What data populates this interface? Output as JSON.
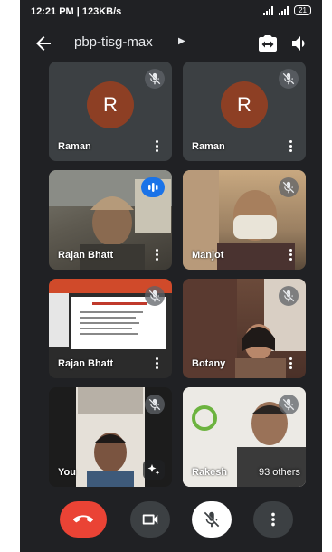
{
  "status_bar": {
    "time_speed": "12:21 PM | 123KB/s",
    "battery": "21"
  },
  "meeting": {
    "title": "pbp-tisg-max"
  },
  "tiles": [
    {
      "name": "Raman",
      "avatar_letter": "R"
    },
    {
      "name": "Raman",
      "avatar_letter": "R"
    },
    {
      "name": "Rajan Bhatt"
    },
    {
      "name": "Manjot"
    },
    {
      "name": "Rajan Bhatt"
    },
    {
      "name": "Botany"
    },
    {
      "name": "You"
    },
    {
      "name": "Rakesh",
      "others": "93 others"
    }
  ],
  "colors": {
    "background": "#202124",
    "avatar": "#8d3f24",
    "end_call": "#ea4335",
    "speaking": "#1a73e8"
  },
  "icons": [
    "back-arrow-icon",
    "switch-camera-icon",
    "speaker-icon",
    "mic-off-icon",
    "more-vert-icon",
    "end-call-icon",
    "camera-icon",
    "effects-icon"
  ]
}
